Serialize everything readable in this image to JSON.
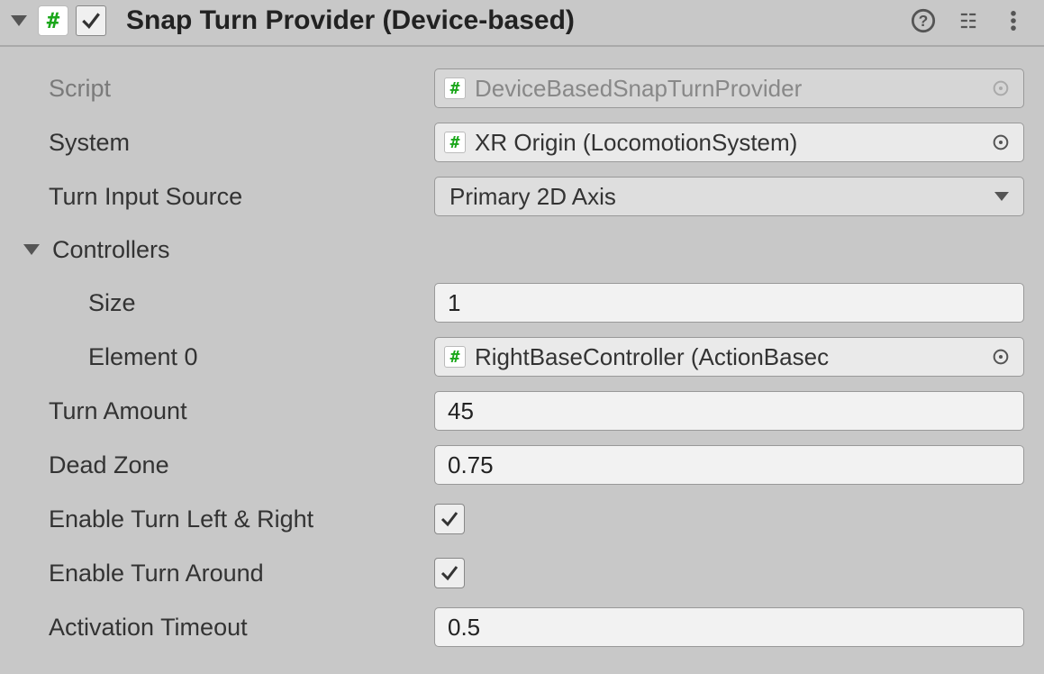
{
  "header": {
    "title": "Snap Turn Provider (Device-based)",
    "enabled": true
  },
  "rows": {
    "script": {
      "label": "Script",
      "value": "DeviceBasedSnapTurnProvider"
    },
    "system": {
      "label": "System",
      "value": "XR Origin (LocomotionSystem)"
    },
    "turnInputSource": {
      "label": "Turn Input Source",
      "value": "Primary 2D Axis"
    },
    "controllers": {
      "label": "Controllers",
      "size": {
        "label": "Size",
        "value": "1"
      },
      "element0": {
        "label": "Element 0",
        "value": "RightBaseController (ActionBasec"
      }
    },
    "turnAmount": {
      "label": "Turn Amount",
      "value": "45"
    },
    "deadZone": {
      "label": "Dead Zone",
      "value": "0.75"
    },
    "enableTurnLR": {
      "label": "Enable Turn Left & Right",
      "checked": true
    },
    "enableTurnAround": {
      "label": "Enable Turn Around",
      "checked": true
    },
    "activationTimeout": {
      "label": "Activation Timeout",
      "value": "0.5"
    }
  }
}
